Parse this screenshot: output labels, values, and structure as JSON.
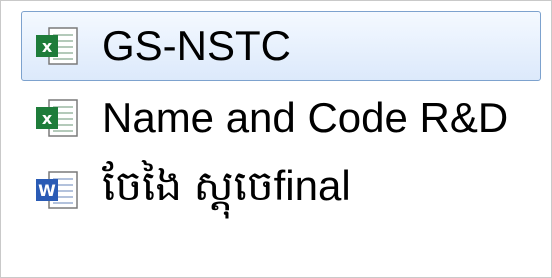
{
  "items": [
    {
      "label": "GS-NSTC",
      "icon": "excel-file-icon",
      "selected": true
    },
    {
      "label": "Name and Code R&D",
      "icon": "excel-file-icon",
      "selected": false
    },
    {
      "label": "ចែងៃ ស្ដុចេfinal",
      "icon": "word-file-icon",
      "selected": false
    }
  ],
  "colors": {
    "selection_border": "#7da2ce",
    "excel_green": "#1e7c3a",
    "word_blue": "#2a5bb5"
  }
}
